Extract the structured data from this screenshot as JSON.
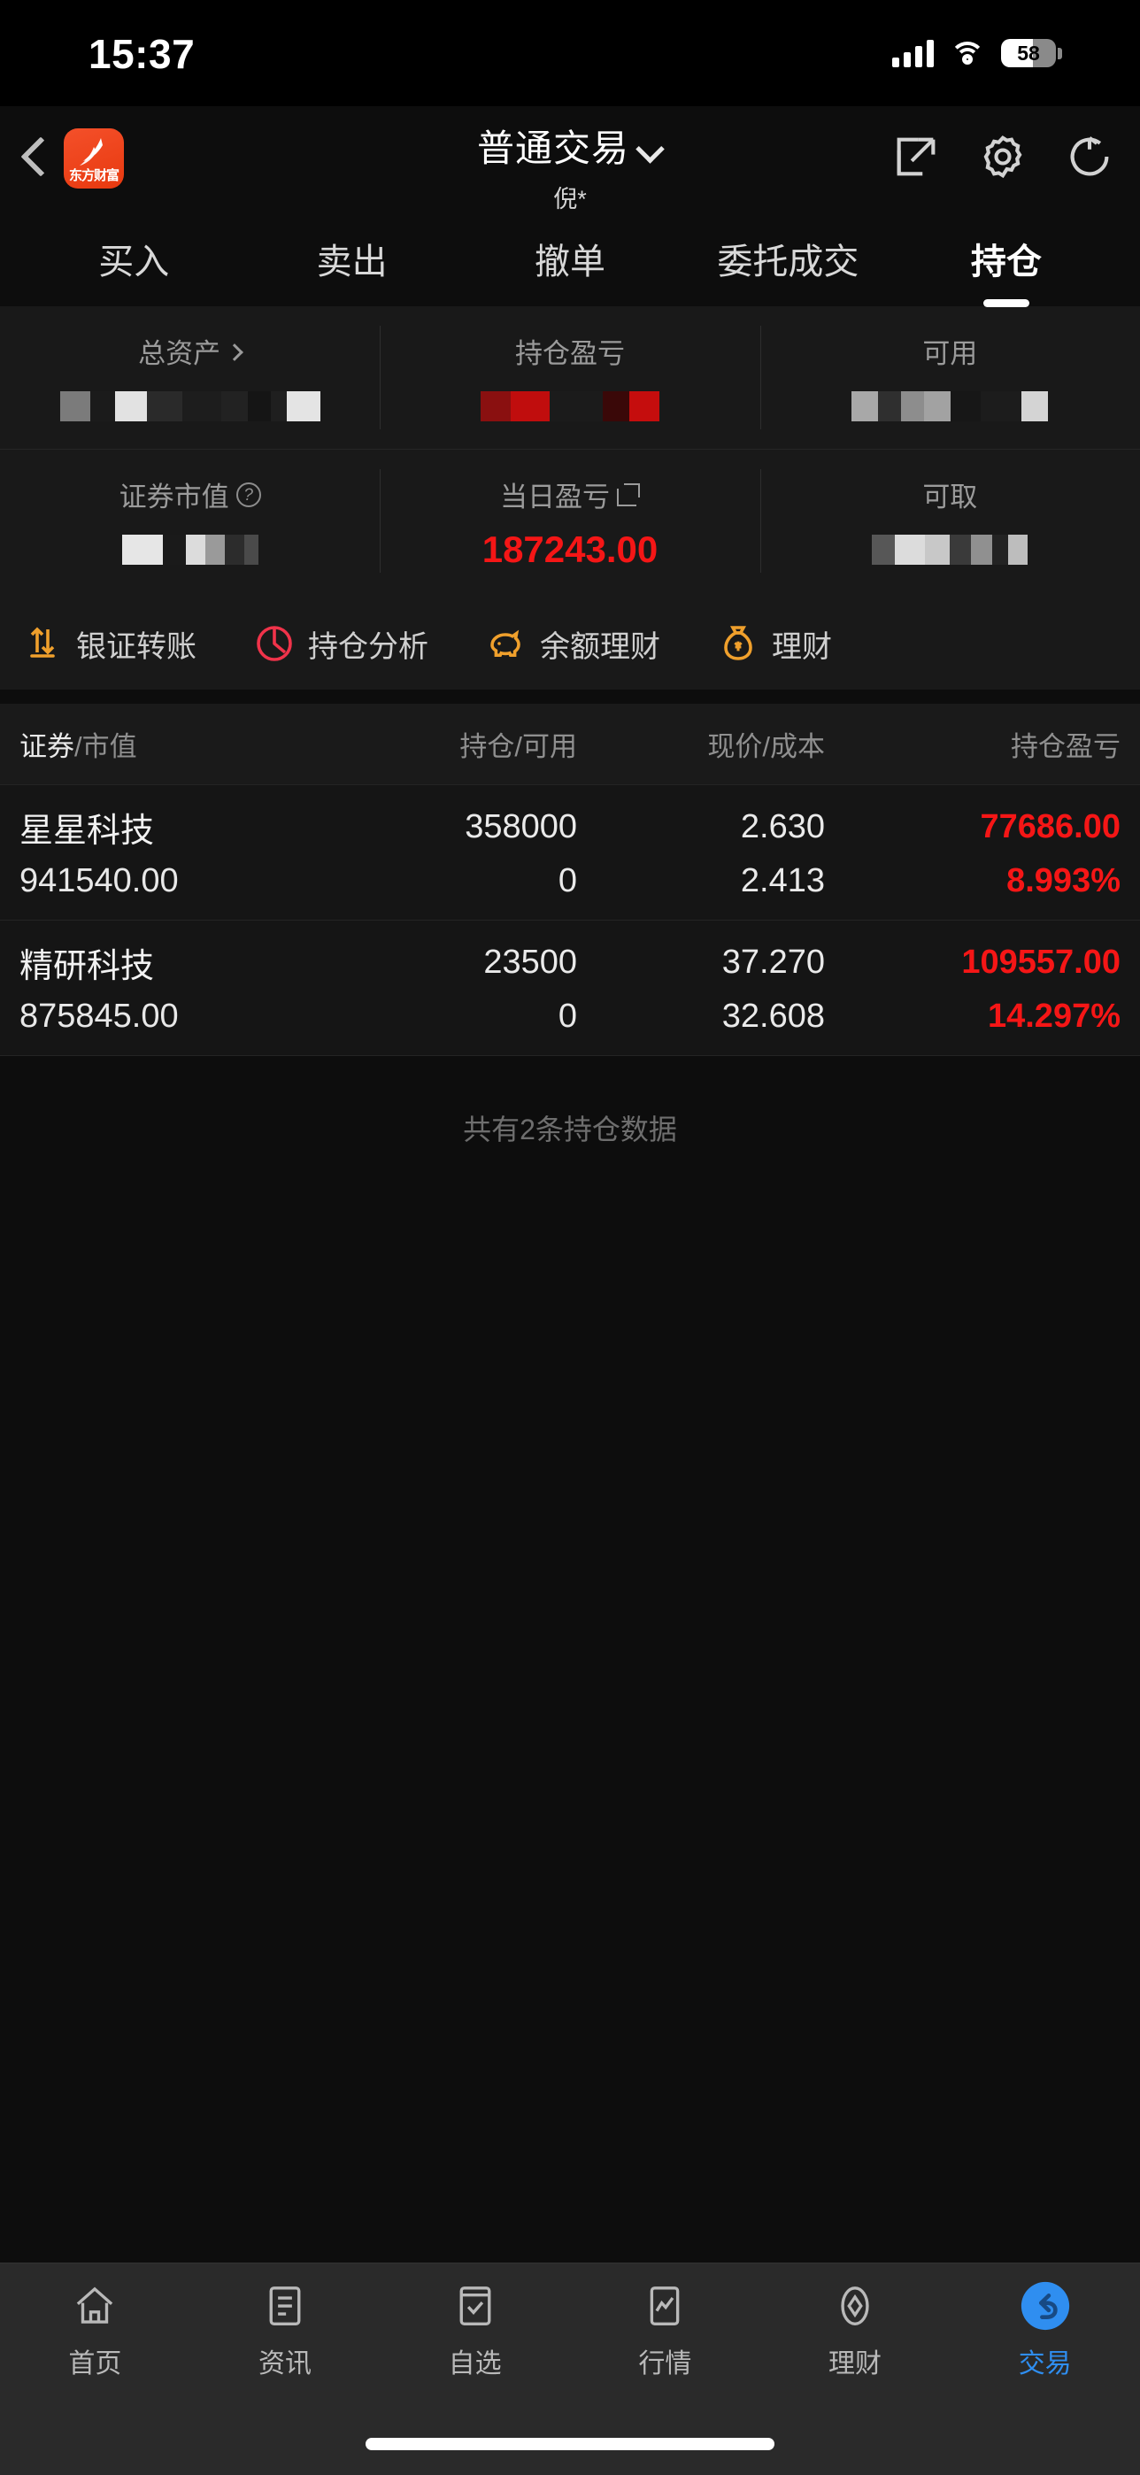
{
  "status_bar": {
    "time": "15:37",
    "battery_level": "58",
    "signal_icon": "cellular-signal-icon",
    "wifi_icon": "wifi-icon",
    "battery_icon": "battery-icon"
  },
  "header": {
    "back_icon": "back-chevron-icon",
    "logo_text": "东方财富",
    "title": "普通交易",
    "subtitle": "倪*",
    "dropdown_icon": "chevron-down-icon",
    "share_icon": "external-link-icon",
    "settings_icon": "gear-icon",
    "refresh_icon": "refresh-icon"
  },
  "tabs": [
    {
      "label": "买入",
      "active": false
    },
    {
      "label": "卖出",
      "active": false
    },
    {
      "label": "撤单",
      "active": false
    },
    {
      "label": "委托成交",
      "active": false
    },
    {
      "label": "持仓",
      "active": true
    }
  ],
  "assets": {
    "row1": [
      {
        "label": "总资产",
        "value": "",
        "redacted": true,
        "icon": "chevron-right-icon"
      },
      {
        "label": "持仓盈亏",
        "value": "",
        "redacted": true,
        "redact_color": "#8e1010"
      },
      {
        "label": "可用",
        "value": "",
        "redacted": true
      }
    ],
    "row2": [
      {
        "label": "证券市值",
        "value": "",
        "redacted": true,
        "icon": "question-mark-icon"
      },
      {
        "label": "当日盈亏",
        "value": "187243.00",
        "redacted": false,
        "icon": "external-link-icon",
        "color": "#f51616"
      },
      {
        "label": "可取",
        "value": "",
        "redacted": true
      }
    ]
  },
  "quick_actions": [
    {
      "label": "银证转账",
      "icon": "transfer-arrows-icon",
      "color": "#f0a02c"
    },
    {
      "label": "持仓分析",
      "icon": "pie-chart-icon",
      "color": "#f0334a"
    },
    {
      "label": "余额理财",
      "icon": "piggy-bank-icon",
      "color": "#f0a02c"
    },
    {
      "label": "理财",
      "icon": "money-bag-icon",
      "color": "#f0a02c"
    }
  ],
  "table": {
    "headers": {
      "col1_primary": "证券",
      "col1_secondary": "/市值",
      "col2": "持仓/可用",
      "col3": "现价/成本",
      "col4": "持仓盈亏"
    },
    "rows": [
      {
        "name": "星星科技",
        "market_value": "941540.00",
        "position": "358000",
        "available": "0",
        "current_price": "2.630",
        "cost_price": "2.413",
        "profit_loss": "77686.00",
        "profit_loss_pct": "8.993%"
      },
      {
        "name": "精研科技",
        "market_value": "875845.00",
        "position": "23500",
        "available": "0",
        "current_price": "37.270",
        "cost_price": "32.608",
        "profit_loss": "109557.00",
        "profit_loss_pct": "14.297%"
      }
    ],
    "footer_note": "共有2条持仓数据"
  },
  "bottom_nav": [
    {
      "label": "首页",
      "icon": "home-icon",
      "active": false
    },
    {
      "label": "资讯",
      "icon": "news-list-icon",
      "active": false
    },
    {
      "label": "自选",
      "icon": "watchlist-check-icon",
      "active": false
    },
    {
      "label": "行情",
      "icon": "market-chart-icon",
      "active": false
    },
    {
      "label": "理财",
      "icon": "diamond-finance-icon",
      "active": false
    },
    {
      "label": "交易",
      "icon": "trade-arrow-icon",
      "active": true
    }
  ],
  "colors": {
    "up_red": "#f51616",
    "accent_blue": "#2f8ef0",
    "brand_orange": "#e8390f"
  }
}
